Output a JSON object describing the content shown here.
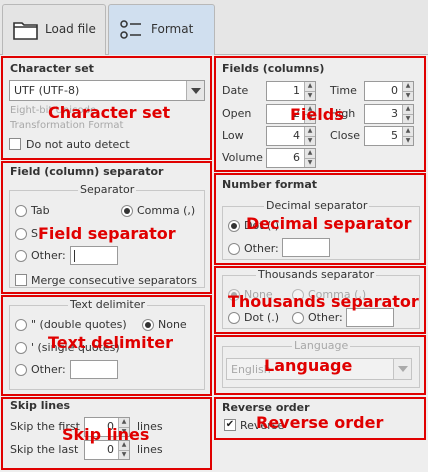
{
  "tabs": [
    {
      "label": "Load file",
      "icon": "folder-icon"
    },
    {
      "label": "Format",
      "icon": "settings-list-icon"
    }
  ],
  "charset": {
    "title": "Character set",
    "selected": "UTF (UTF-8)",
    "description_line1": "Eight-bit Unicode",
    "description_line2": "Transformation Format",
    "no_auto_detect_label": "Do not auto detect",
    "overlay": "Character set"
  },
  "field_separator": {
    "title": "Field (column) separator",
    "group_title": "Separator",
    "tab_label": "Tab",
    "comma_label": "Comma (,)",
    "semicolon_label": "S",
    "other_label": "Other:",
    "other_value": "",
    "merge_label": "Merge consecutive separators",
    "overlay": "Field separator"
  },
  "text_delimiter": {
    "group_title": "Text delimiter",
    "double_quotes_label": "\" (double quotes)",
    "none_label": "None",
    "single_quotes_label": "' (single quotes)",
    "other_label": "Other:",
    "other_value": "",
    "overlay": "Text delimiter"
  },
  "skip_lines": {
    "title": "Skip lines",
    "first_label": "Skip the first",
    "first_value": "0",
    "first_suffix": "lines",
    "last_label": "Skip the last",
    "last_value": "0",
    "last_suffix": "lines",
    "overlay": "Skip lines"
  },
  "fields": {
    "title": "Fields (columns)",
    "date_label": "Date",
    "date_value": "1",
    "open_label": "Open",
    "open_value": "2",
    "low_label": "Low",
    "low_value": "4",
    "volume_label": "Volume",
    "volume_value": "6",
    "time_label": "Time",
    "time_value": "0",
    "high_label": "High",
    "high_value": "3",
    "close_label": "Close",
    "close_value": "5",
    "overlay": "Fields"
  },
  "number_format": {
    "title": "Number format",
    "decimal_group_title": "Decimal separator",
    "decimal_dot_label": "Dot (.)",
    "decimal_other_label": "Other:",
    "decimal_other_value": "",
    "decimal_overlay": "Decimal separator",
    "thousands_group_title": "Thousands separator",
    "thousands_none_label": "None",
    "thousands_comma_label": "Comma (,)",
    "thousands_dot_label": "Dot (.)",
    "thousands_other_label": "Other:",
    "thousands_other_value": "",
    "thousands_overlay": "Thousands separator"
  },
  "language": {
    "group_title": "Language",
    "selected": "English",
    "overlay": "Language"
  },
  "reverse_order": {
    "title": "Reverse order",
    "checkbox_label": "Reverse",
    "checked": true,
    "overlay": "Reverse order"
  }
}
